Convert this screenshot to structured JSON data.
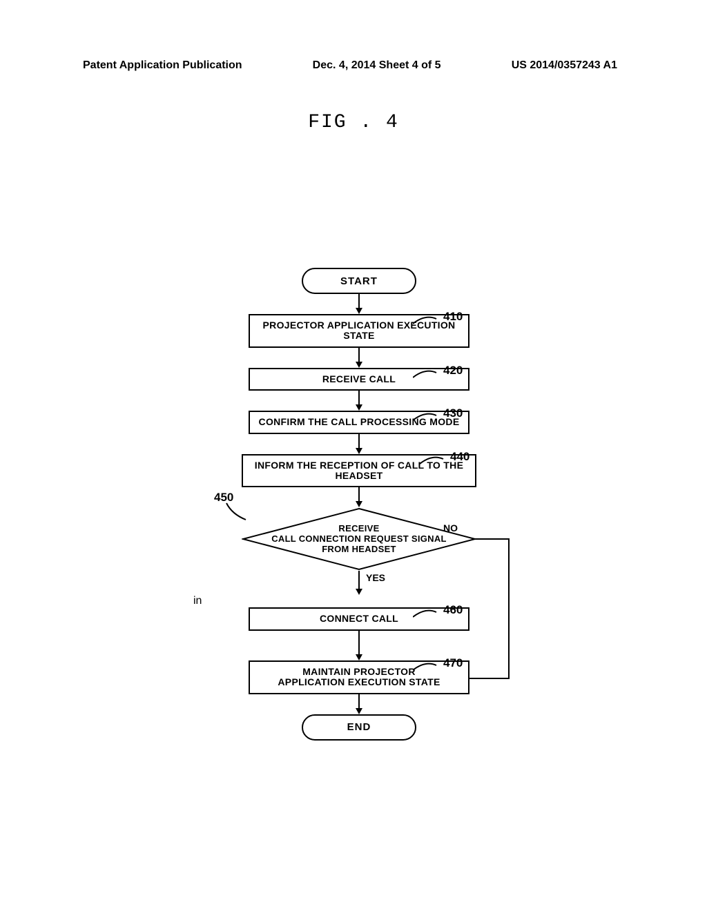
{
  "header": {
    "left": "Patent Application Publication",
    "center": "Dec. 4, 2014  Sheet 4 of 5",
    "right": "US 2014/0357243 A1"
  },
  "figure_label": "FIG . 4",
  "nodes": {
    "start": "START",
    "step410": "PROJECTOR APPLICATION EXECUTION STATE",
    "step420": "RECEIVE CALL",
    "step430": "CONFIRM THE CALL PROCESSING MODE",
    "step440": "INFORM THE RECEPTION OF CALL TO THE HEADSET",
    "step450_l1": "RECEIVE",
    "step450_l2": "CALL CONNECTION REQUEST SIGNAL",
    "step450_l3": "FROM HEADSET",
    "step460": "CONNECT CALL",
    "step470_l1": "MAINTAIN PROJECTOR",
    "step470_l2": "APPLICATION EXECUTION STATE",
    "end": "END"
  },
  "refs": {
    "r410": "410",
    "r420": "420",
    "r430": "430",
    "r440": "440",
    "r450": "450",
    "r460": "460",
    "r470": "470"
  },
  "branches": {
    "yes": "YES",
    "no": "NO"
  },
  "chart_data": {
    "type": "flowchart",
    "nodes": [
      {
        "id": "start",
        "type": "terminator",
        "label": "START"
      },
      {
        "id": "410",
        "type": "process",
        "label": "PROJECTOR APPLICATION EXECUTION STATE"
      },
      {
        "id": "420",
        "type": "process",
        "label": "RECEIVE CALL"
      },
      {
        "id": "430",
        "type": "process",
        "label": "CONFIRM THE CALL PROCESSING MODE"
      },
      {
        "id": "440",
        "type": "process",
        "label": "INFORM THE RECEPTION OF CALL TO THE HEADSET"
      },
      {
        "id": "450",
        "type": "decision",
        "label": "RECEIVE CALL CONNECTION REQUEST SIGNAL FROM HEADSET"
      },
      {
        "id": "460",
        "type": "process",
        "label": "CONNECT CALL"
      },
      {
        "id": "470",
        "type": "process",
        "label": "MAINTAIN PROJECTOR APPLICATION EXECUTION STATE"
      },
      {
        "id": "end",
        "type": "terminator",
        "label": "END"
      }
    ],
    "edges": [
      {
        "from": "start",
        "to": "410"
      },
      {
        "from": "410",
        "to": "420"
      },
      {
        "from": "420",
        "to": "430"
      },
      {
        "from": "430",
        "to": "440"
      },
      {
        "from": "440",
        "to": "450"
      },
      {
        "from": "450",
        "to": "460",
        "label": "YES"
      },
      {
        "from": "450",
        "to": "470",
        "label": "NO"
      },
      {
        "from": "460",
        "to": "470"
      },
      {
        "from": "470",
        "to": "end"
      }
    ]
  }
}
